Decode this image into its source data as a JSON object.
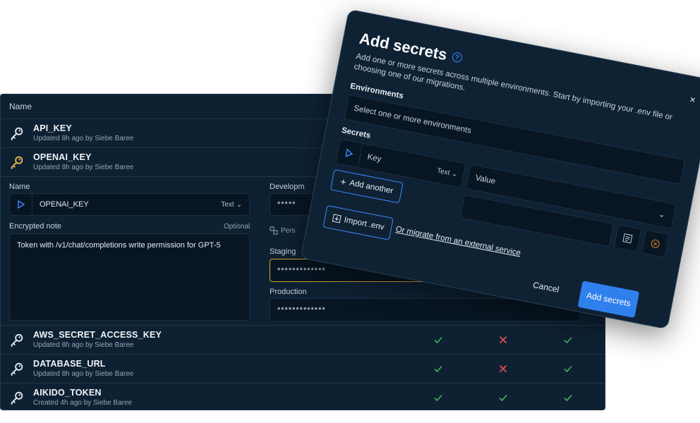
{
  "table": {
    "header": "Name",
    "rows_top": [
      {
        "name": "API_KEY",
        "meta": "Updated 8h ago by Siebe Baree",
        "key_color": "#e6edf3"
      },
      {
        "name": "OPENAI_KEY",
        "meta": "Updated 8h ago by Siebe Baree",
        "key_color": "#f2b84b"
      }
    ],
    "rows_bottom": [
      {
        "name": "AWS_SECRET_ACCESS_KEY",
        "meta": "Updated 8h ago by Siebe Baree",
        "status": [
          "check",
          "cross",
          "check"
        ]
      },
      {
        "name": "DATABASE_URL",
        "meta": "Updated 8h ago by Siebe Baree",
        "status": [
          "check",
          "cross",
          "check"
        ]
      },
      {
        "name": "AIKIDO_TOKEN",
        "meta": "Created 4h ago by Siebe Baree",
        "status": [
          "check",
          "check",
          "check"
        ]
      }
    ]
  },
  "editor": {
    "name_label": "Name",
    "name_value": "OPENAI_KEY",
    "type_value": "Text",
    "note_label": "Encrypted note",
    "note_optional": "Optional",
    "note_value": "Token with /v1/chat/completions write permission for GPT-5",
    "dev_label": "Developm",
    "dev_value": "*****",
    "persist_label": "Pers",
    "staging_label": "Staging",
    "staging_value": "*************",
    "prod_label": "Production",
    "prod_value": "*************"
  },
  "modal": {
    "title": "Add secrets",
    "help": "?",
    "description": "Add one or more secrets across multiple environments. Start by importing your .env file or choosing one of our migrations.",
    "close": "×",
    "env_label": "Environments",
    "env_placeholder": "Select one or more environments",
    "secrets_label": "Secrets",
    "key_placeholder": "Key",
    "type_value": "Text",
    "value_placeholder": "Value",
    "add_another": "Add another",
    "import_env": "Import .env",
    "migrate_link": "Or migrate from an external service",
    "cancel": "Cancel",
    "submit": "Add secrets"
  },
  "colors": {
    "check": "#3fb950",
    "cross": "#e5534b",
    "accent": "#2f80ed",
    "staging_border": "#d9a92e"
  }
}
